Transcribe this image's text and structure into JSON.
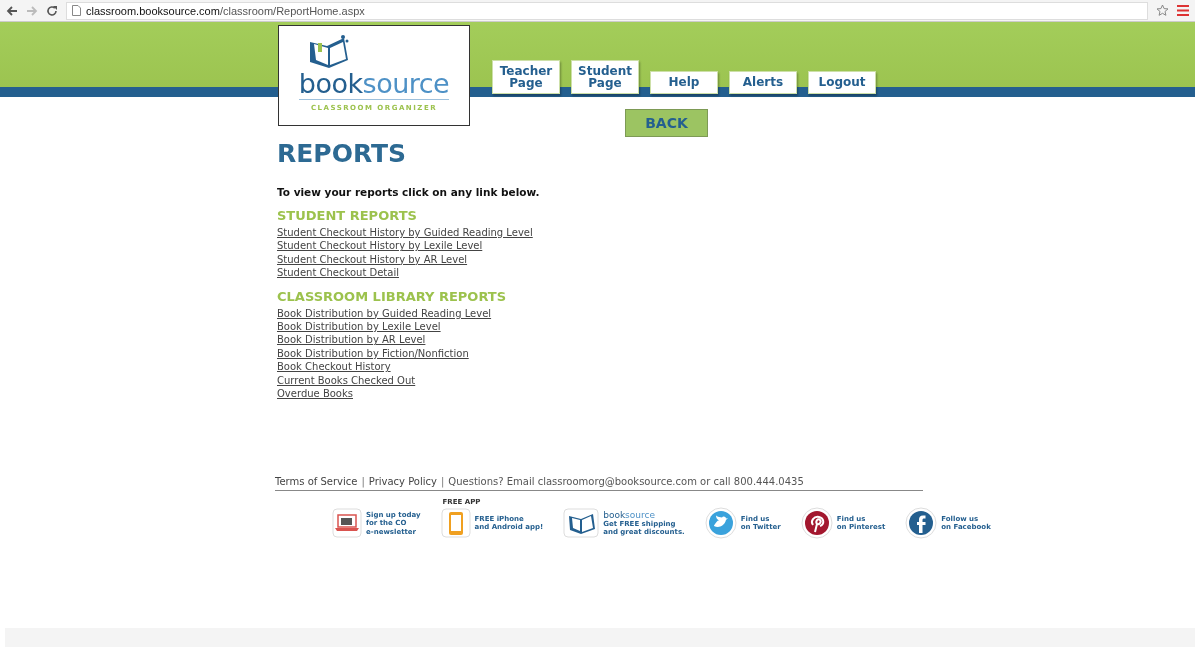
{
  "browser": {
    "url_host": "classroom.booksource.com",
    "url_path": "/classroom/ReportHome.aspx"
  },
  "logo": {
    "word_1": "book",
    "word_2": "source",
    "tagline": "CLASSROOM ORGANIZER"
  },
  "nav": [
    {
      "label": "Teacher\nPage"
    },
    {
      "label": "Student\nPage"
    },
    {
      "label": "Help"
    },
    {
      "label": "Alerts"
    },
    {
      "label": "Logout"
    }
  ],
  "back_button": "BACK",
  "title": "REPORTS",
  "intro": "To view your reports click on any link below.",
  "sections": [
    {
      "heading": "STUDENT REPORTS",
      "links": [
        "Student Checkout History by Guided Reading Level",
        "Student Checkout History by Lexile Level",
        "Student Checkout History by AR Level",
        "Student Checkout Detail"
      ]
    },
    {
      "heading": "CLASSROOM LIBRARY REPORTS",
      "links": [
        "Book Distribution by Guided Reading Level",
        "Book Distribution by Lexile Level",
        "Book Distribution by AR Level",
        "Book Distribution by Fiction/Nonfiction",
        "Book Checkout History",
        "Current Books Checked Out",
        "Overdue Books"
      ]
    }
  ],
  "footer": [
    {
      "kind": "link",
      "text": "Terms of Service"
    },
    {
      "kind": "separator",
      "text": "|"
    },
    {
      "kind": "link",
      "text": "Privacy Policy"
    },
    {
      "kind": "separator",
      "text": "|"
    },
    {
      "kind": "contact",
      "text": "Questions? Email classroomorg@booksource.com or call 800.444.0435"
    }
  ],
  "promos": [
    {
      "kind": "newsletter",
      "text": "Sign up today\nfor the CO\ne-newsletter"
    },
    {
      "kind": "app",
      "badge": "FREE APP",
      "text": "FREE iPhone\nand Android app!"
    },
    {
      "kind": "booksource",
      "brand_1": "book",
      "brand_2": "source",
      "text": "Get FREE shipping\nand great discounts."
    },
    {
      "kind": "twitter",
      "text": "Find us\non Twitter"
    },
    {
      "kind": "pinterest",
      "text": "Find us\non Pinterest"
    },
    {
      "kind": "facebook",
      "text": "Follow us\non Facebook"
    }
  ]
}
